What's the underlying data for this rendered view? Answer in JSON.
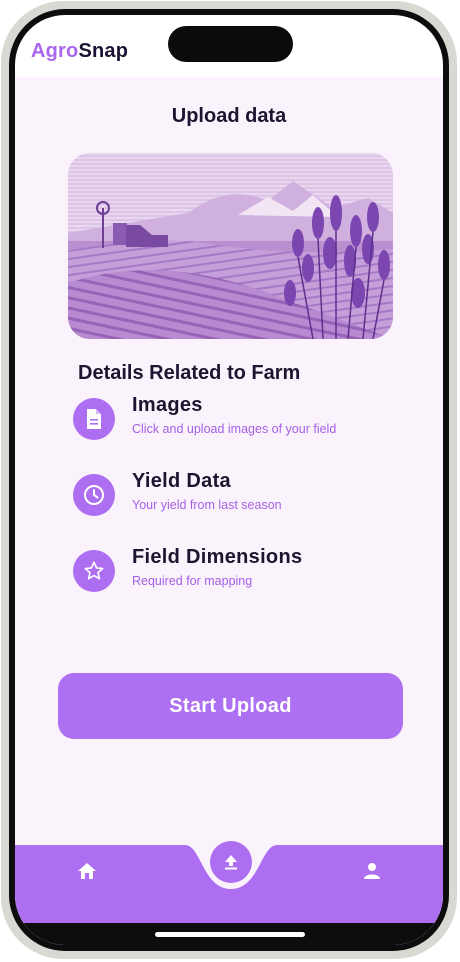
{
  "app": {
    "brand_part1": "Agro",
    "brand_part2": "Snap",
    "accent_color": "#ad6ef2",
    "brand_primary_color": "#a866ee",
    "text_color": "#1d1530"
  },
  "page": {
    "title": "Upload data",
    "hero_image": "lavender-farm-landscape-illustration"
  },
  "details": {
    "section_title": "Details Related to Farm",
    "items": [
      {
        "icon": "document-icon",
        "name": "Images",
        "desc": "Click and upload images of your field"
      },
      {
        "icon": "clock-icon",
        "name": "Yield Data",
        "desc": "Your yield from last season"
      },
      {
        "icon": "star-icon",
        "name": "Field Dimensions",
        "desc": "Required for mapping"
      }
    ]
  },
  "actions": {
    "start_upload": "Start Upload"
  },
  "nav": {
    "items": [
      {
        "icon": "home-icon"
      },
      {
        "icon": "upload-icon",
        "active": true
      },
      {
        "icon": "profile-icon"
      }
    ]
  }
}
